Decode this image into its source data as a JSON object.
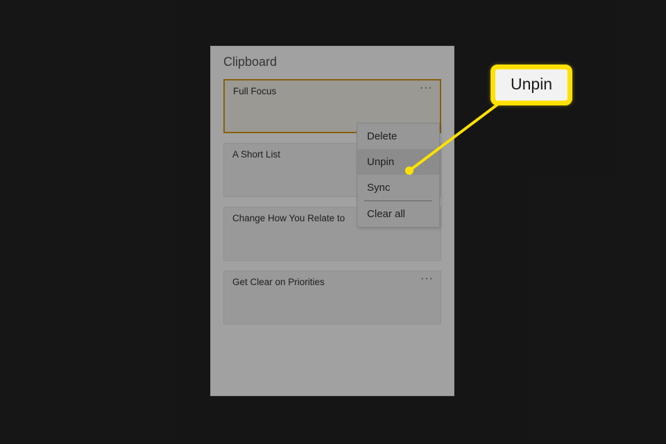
{
  "panel": {
    "title": "Clipboard",
    "cards": [
      {
        "text": "Full Focus",
        "selected": true
      },
      {
        "text": "A Short List",
        "selected": false
      },
      {
        "text": "Change How You Relate to",
        "selected": false
      },
      {
        "text": "Get Clear on Priorities",
        "selected": false
      }
    ],
    "cardMenuGlyph": "···"
  },
  "contextMenu": {
    "items": [
      {
        "label": "Delete",
        "highlight": false,
        "sepAfter": false
      },
      {
        "label": "Unpin",
        "highlight": true,
        "sepAfter": false
      },
      {
        "label": "Sync",
        "highlight": false,
        "sepAfter": true
      },
      {
        "label": "Clear all",
        "highlight": false,
        "sepAfter": false
      }
    ]
  },
  "callout": {
    "label": "Unpin"
  }
}
